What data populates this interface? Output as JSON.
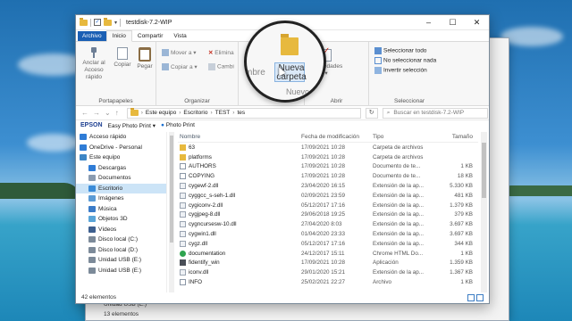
{
  "window": {
    "title": "testdisk-7.2-WIP",
    "controls": [
      "–",
      "☐",
      "✕"
    ]
  },
  "ribbon_tabs": [
    "Archivo",
    "Inicio",
    "Compartir",
    "Vista"
  ],
  "ribbon": {
    "portapapeles": {
      "pin_label": "Anclar al Acceso rápido",
      "copy": "Copiar",
      "paste": "Pegar",
      "group": "Portapapeles"
    },
    "organizar": {
      "move": "Mover a",
      "copy_to": "Copiar a",
      "delete": "Elimina",
      "rename": "Cambi",
      "group": "Organizar"
    },
    "nuevo": {
      "new_folder": "Nueva carpeta",
      "new_folder_line1": "Nueva",
      "new_folder_line2": "carpeta",
      "group": "Nuevo",
      "partial_left": "mbre"
    },
    "abrir": {
      "properties": "Propiedades",
      "group": "Abrir"
    },
    "seleccionar": {
      "all": "Seleccionar todo",
      "none": "No seleccionar nada",
      "invert": "Invertir selección",
      "group": "Seleccionar"
    }
  },
  "address": {
    "back": "←",
    "forward": "→",
    "history": "⌄",
    "up": "↑",
    "path": [
      "Este equipo",
      "Escritorio",
      "TEST",
      "tes"
    ],
    "refresh": "↻",
    "search_placeholder": "Buscar en testdisk-7.2-WIP"
  },
  "epson_bar": {
    "logo": "EPSON",
    "app": "Easy Photo Print",
    "arrow": "▾",
    "photo_print": "Photo Print"
  },
  "sidebar": [
    {
      "label": "Acceso rápido",
      "icon": "star-icon",
      "color": "#2f7cd6"
    },
    {
      "label": "OneDrive - Personal",
      "icon": "cloud-icon",
      "color": "#2f7cd6"
    },
    {
      "label": "Este equipo",
      "icon": "computer-icon",
      "color": "#3d86c6"
    },
    {
      "label": "Descargas",
      "icon": "download-icon",
      "color": "#2f7cd6"
    },
    {
      "label": "Documentos",
      "icon": "documents-icon",
      "color": "#8a9bb0"
    },
    {
      "label": "Escritorio",
      "icon": "desktop-icon",
      "color": "#3a8bd8",
      "selected": true
    },
    {
      "label": "Imágenes",
      "icon": "pictures-icon",
      "color": "#5b9bd5"
    },
    {
      "label": "Música",
      "icon": "music-icon",
      "color": "#3a7bc8"
    },
    {
      "label": "Objetos 3D",
      "icon": "3d-objects-icon",
      "color": "#5aa5d8"
    },
    {
      "label": "Vídeos",
      "icon": "videos-icon",
      "color": "#3d5f8f"
    },
    {
      "label": "Disco local (C:)",
      "icon": "drive-icon",
      "color": "#7c8a99"
    },
    {
      "label": "Disco local (D:)",
      "icon": "drive-icon",
      "color": "#7c8a99"
    },
    {
      "label": "Unidad USB (E:)",
      "icon": "usb-drive-icon",
      "color": "#7c8a99"
    },
    {
      "label": "Unidad USB (E:)",
      "icon": "usb-drive-icon",
      "color": "#7c8a99"
    }
  ],
  "columns": [
    "Nombre",
    "Fecha de modificación",
    "Tipo",
    "Tamaño"
  ],
  "files": [
    {
      "name": "63",
      "date": "17/09/2021 10:28",
      "type": "Carpeta de archivos",
      "size": "",
      "icon": "folder"
    },
    {
      "name": "platforms",
      "date": "17/09/2021 10:28",
      "type": "Carpeta de archivos",
      "size": "",
      "icon": "folder"
    },
    {
      "name": "AUTHORS",
      "date": "17/09/2021 10:28",
      "type": "Documento de te...",
      "size": "1 KB",
      "icon": "doc"
    },
    {
      "name": "COPYING",
      "date": "17/09/2021 10:28",
      "type": "Documento de te...",
      "size": "18 KB",
      "icon": "doc"
    },
    {
      "name": "cygewf-2.dll",
      "date": "23/04/2020 16:15",
      "type": "Extensión de la ap...",
      "size": "5.330 KB",
      "icon": "dll"
    },
    {
      "name": "cyggcc_s-seh-1.dll",
      "date": "02/09/2021 23:59",
      "type": "Extensión de la ap...",
      "size": "481 KB",
      "icon": "dll"
    },
    {
      "name": "cygiconv-2.dll",
      "date": "05/12/2017 17:16",
      "type": "Extensión de la ap...",
      "size": "1.379 KB",
      "icon": "dll"
    },
    {
      "name": "cygjpeg-8.dll",
      "date": "29/06/2018 19:25",
      "type": "Extensión de la ap...",
      "size": "379 KB",
      "icon": "dll"
    },
    {
      "name": "cygncursesw-10.dll",
      "date": "27/04/2020 8:03",
      "type": "Extensión de la ap...",
      "size": "3.697 KB",
      "icon": "dll"
    },
    {
      "name": "cygwin1.dll",
      "date": "01/04/2020 23:33",
      "type": "Extensión de la ap...",
      "size": "3.697 KB",
      "icon": "dll"
    },
    {
      "name": "cygz.dll",
      "date": "05/12/2017 17:16",
      "type": "Extensión de la ap...",
      "size": "344 KB",
      "icon": "dll"
    },
    {
      "name": "documentation",
      "date": "24/12/2017 15:11",
      "type": "Chrome HTML Do...",
      "size": "1 KB",
      "icon": "chrome"
    },
    {
      "name": "fidentify_win",
      "date": "17/09/2021 10:28",
      "type": "Aplicación",
      "size": "1.359 KB",
      "icon": "exe"
    },
    {
      "name": "iconv.dll",
      "date": "29/01/2020 15:21",
      "type": "Extensión de la ap...",
      "size": "1.367 KB",
      "icon": "dll"
    },
    {
      "name": "INFO",
      "date": "25/02/2021 22:27",
      "type": "Archivo",
      "size": "1 KB",
      "icon": "doc"
    }
  ],
  "status": {
    "count": "42 elementos"
  },
  "background_window": {
    "status": "13 elementos",
    "partial_row": "Unidad USB (E:)"
  }
}
